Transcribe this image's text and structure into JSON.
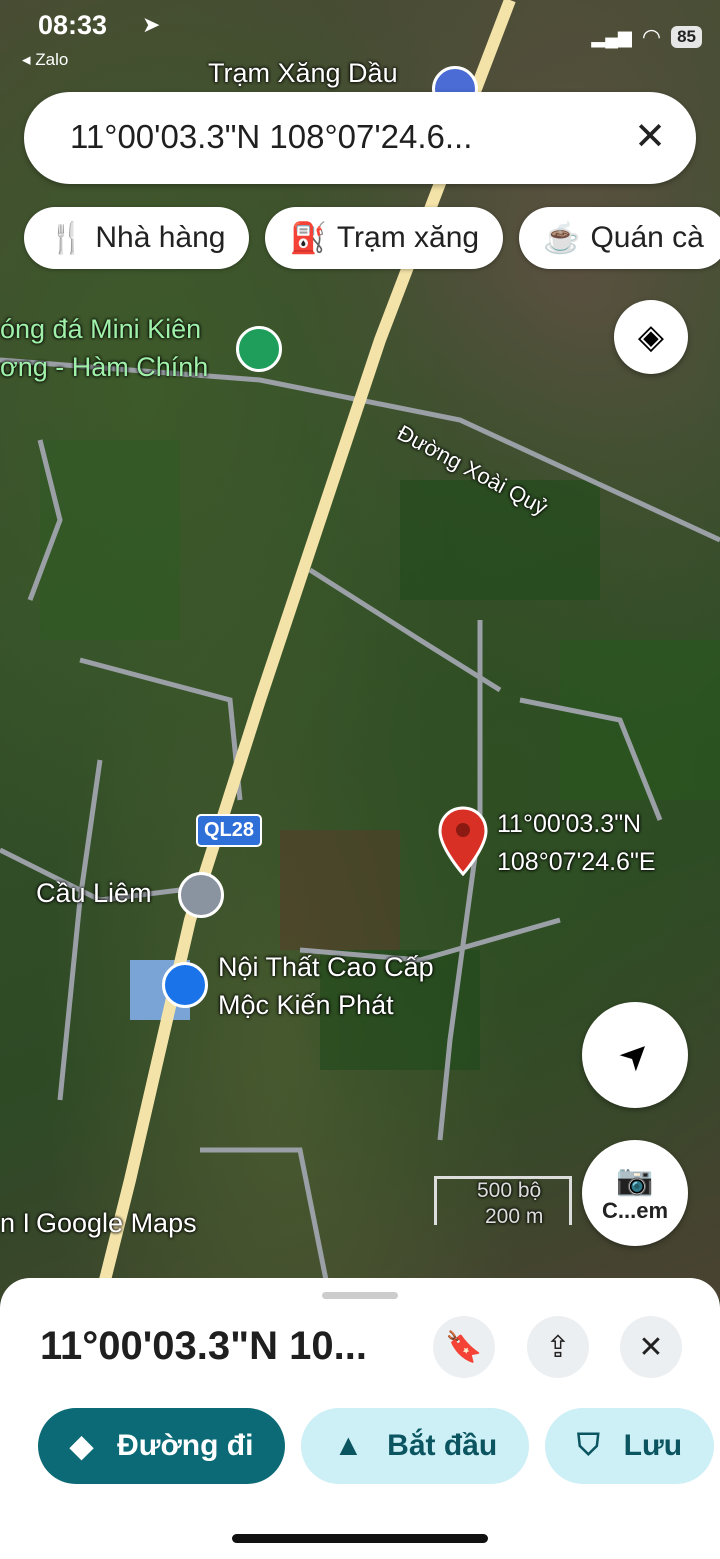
{
  "status_bar": {
    "time": "08:33",
    "back_app": "◂ Zalo",
    "battery": "85"
  },
  "search": {
    "query": "11°00'03.3\"N 108°07'24.6..."
  },
  "chips": [
    {
      "label": "Nhà hàng",
      "icon": "fork-knife-icon"
    },
    {
      "label": "Trạm xăng",
      "icon": "fuel-pump-icon"
    },
    {
      "label": "Quán cà"
    }
  ],
  "map": {
    "labels": {
      "gas_station": "Trạm Xăng Dầu",
      "football": "óng đá Mini Kiên",
      "football2": "ơng - Hàm Chính",
      "street": "Đường Xoài Quỷ",
      "highway": "QL28",
      "bridge": "Cầu Liêm",
      "furniture": "Nội Thất Cao Cấp",
      "furniture2": "Mộc Kiến Phát",
      "pin_lat": "11°00'03.3\"N",
      "pin_lng": "108°07'24.6\"E",
      "scale_ft": "500 bộ",
      "scale_m": "200 m",
      "google_maps": "Google Maps",
      "left_cut": "n I"
    },
    "camera_label": "C...em"
  },
  "sheet": {
    "title": "11°00'03.3\"N 10...",
    "actions": [
      {
        "label": "Đường đi"
      },
      {
        "label": "Bắt đầu"
      },
      {
        "label": "Lưu"
      }
    ]
  },
  "colors": {
    "primary": "#0b6a75",
    "secondary": "#cdeff6",
    "pin": "#d93025"
  }
}
